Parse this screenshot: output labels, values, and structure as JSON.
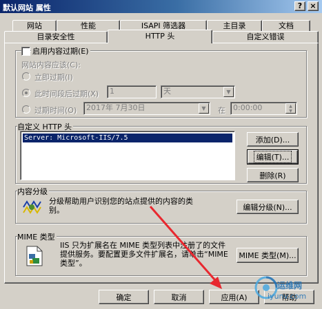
{
  "window": {
    "title": "默认网站 属性",
    "help_button": "?",
    "close_button": "×"
  },
  "tabs_row1": [
    "网站",
    "性能",
    "ISAPI 筛选器",
    "主目录",
    "文档"
  ],
  "tabs_row2": [
    "目录安全性",
    "HTTP 头",
    "自定义错误"
  ],
  "active_tab": "HTTP 头",
  "expiration": {
    "enable_label": "启用内容过期(E)",
    "enabled": false,
    "content_should_label": "网站内容应该(C):",
    "immediate_label": "立即过期(I)",
    "after_label": "此时间段后过期(X)",
    "after_value": "1",
    "after_unit": "天",
    "on_label": "过期时间(O)",
    "on_date": "2017年 7月30日",
    "at_label": "在",
    "on_time": "0:00:00"
  },
  "custom_headers": {
    "label": "自定义 HTTP 头",
    "items": [
      "Server: Microsoft-IIS/7.5"
    ],
    "add_label": "添加(D)...",
    "edit_label": "编辑(T)...",
    "delete_label": "删除(R)"
  },
  "rating": {
    "label": "内容分级",
    "description": "分级帮助用户识别您的站点提供的内容的类别。",
    "edit_label": "编辑分级(N)..."
  },
  "mime": {
    "label": "MIME 类型",
    "description": "IIS 只为扩展名在 MIME 类型列表中注册了的文件提供服务。要配置更多文件扩展名，请单击“MIME 类型”。",
    "button_label": "MIME 类型(M)..."
  },
  "footer": {
    "ok": "确定",
    "cancel": "取消",
    "apply": "应用(A)",
    "help": "帮助"
  },
  "watermark": {
    "name": "运维网",
    "url": "iyunv.com"
  },
  "colors": {
    "annotation_arrow": "#e8282f",
    "selection": "#0a246a",
    "face": "#d4d0c8"
  }
}
